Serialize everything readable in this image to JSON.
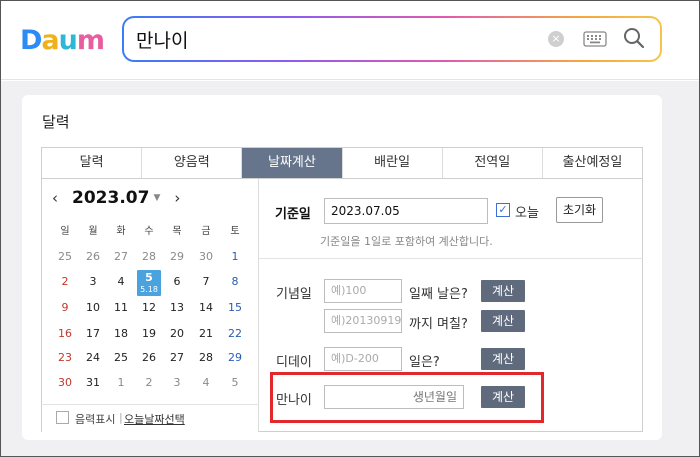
{
  "header": {
    "logo": {
      "letters": [
        "D",
        "a",
        "u",
        "m"
      ],
      "colors": [
        "#2a8cf4",
        "#f2b11a",
        "#2fb7d7",
        "#e85da0"
      ]
    },
    "search": {
      "value": "만나이",
      "clear_icon": "×"
    }
  },
  "card": {
    "title": "달력",
    "tabs": [
      "달력",
      "양음력",
      "날짜계산",
      "배란일",
      "전역일",
      "출산예정일"
    ],
    "active_tab": "날짜계산"
  },
  "calendar": {
    "prev": "‹",
    "next": "›",
    "month": "2023.07",
    "dropdown": "▼",
    "weekdays": [
      "일",
      "월",
      "화",
      "수",
      "목",
      "금",
      "토"
    ],
    "weeks": [
      [
        "25",
        "26",
        "27",
        "28",
        "29",
        "30",
        "1"
      ],
      [
        "2",
        "3",
        "4",
        "5",
        "6",
        "7",
        "8"
      ],
      [
        "9",
        "10",
        "11",
        "12",
        "13",
        "14",
        "15"
      ],
      [
        "16",
        "17",
        "18",
        "19",
        "20",
        "21",
        "22"
      ],
      [
        "23",
        "24",
        "25",
        "26",
        "27",
        "28",
        "29"
      ],
      [
        "30",
        "31",
        "1",
        "2",
        "3",
        "4",
        "5"
      ]
    ],
    "today": {
      "day": "5",
      "lunar": "5.18"
    },
    "footer_label": "음력표시",
    "footer_link": "오늘날짜선택"
  },
  "calc": {
    "base_label": "기준일",
    "base_value": "2023.07.05",
    "today_check": "✓",
    "today_label": "오늘",
    "reset_button": "초기화",
    "hint": "기준일을 1일로 포함하여 계산합니다.",
    "anniv_label": "기념일",
    "anniv_placeholder": "예)100",
    "anniv_suffix": "일째 날은?",
    "since_placeholder": "예)20130919",
    "since_suffix": "까지 며칠?",
    "dday_label": "디데이",
    "dday_placeholder": "예)D-200",
    "dday_suffix": "일은?",
    "age_label": "만나이",
    "age_placeholder": "생년월일",
    "calc_button": "계산"
  },
  "colors": {
    "tab_active": "#67758c",
    "button": "#5f6a7d",
    "highlight": "#e2282c",
    "today": "#4aa3df"
  }
}
